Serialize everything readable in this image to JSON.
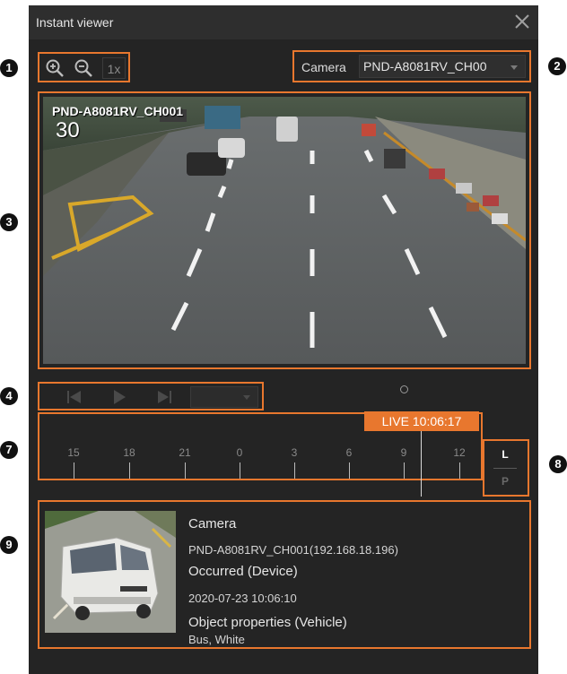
{
  "window": {
    "title": "Instant viewer"
  },
  "zoom": {
    "level_label": "1x"
  },
  "camera": {
    "label": "Camera",
    "selected": "PND-A8081RV_CH00"
  },
  "video": {
    "overlay_name": "PND-A8081RV_CH001",
    "overlay_fps": "30"
  },
  "timeline": {
    "ticks": [
      "15",
      "18",
      "21",
      "0",
      "3",
      "6",
      "9",
      "12"
    ],
    "live_label": "LIVE 10:06:17",
    "mode_buttons": [
      "L",
      "P"
    ]
  },
  "event": {
    "camera_heading": "Camera",
    "camera_value": "PND-A8081RV_CH001(192.168.18.196)",
    "occurred_heading": "Occurred (Device)",
    "occurred_value": "2020-07-23 10:06:10",
    "object_heading": "Object properties (Vehicle)",
    "object_value": "Bus, White"
  },
  "callouts": [
    "1",
    "2",
    "3",
    "4",
    "7",
    "8",
    "9"
  ],
  "colors": {
    "accent": "#e8772e",
    "background": "#242424",
    "titlebar": "#2e2e2e"
  }
}
